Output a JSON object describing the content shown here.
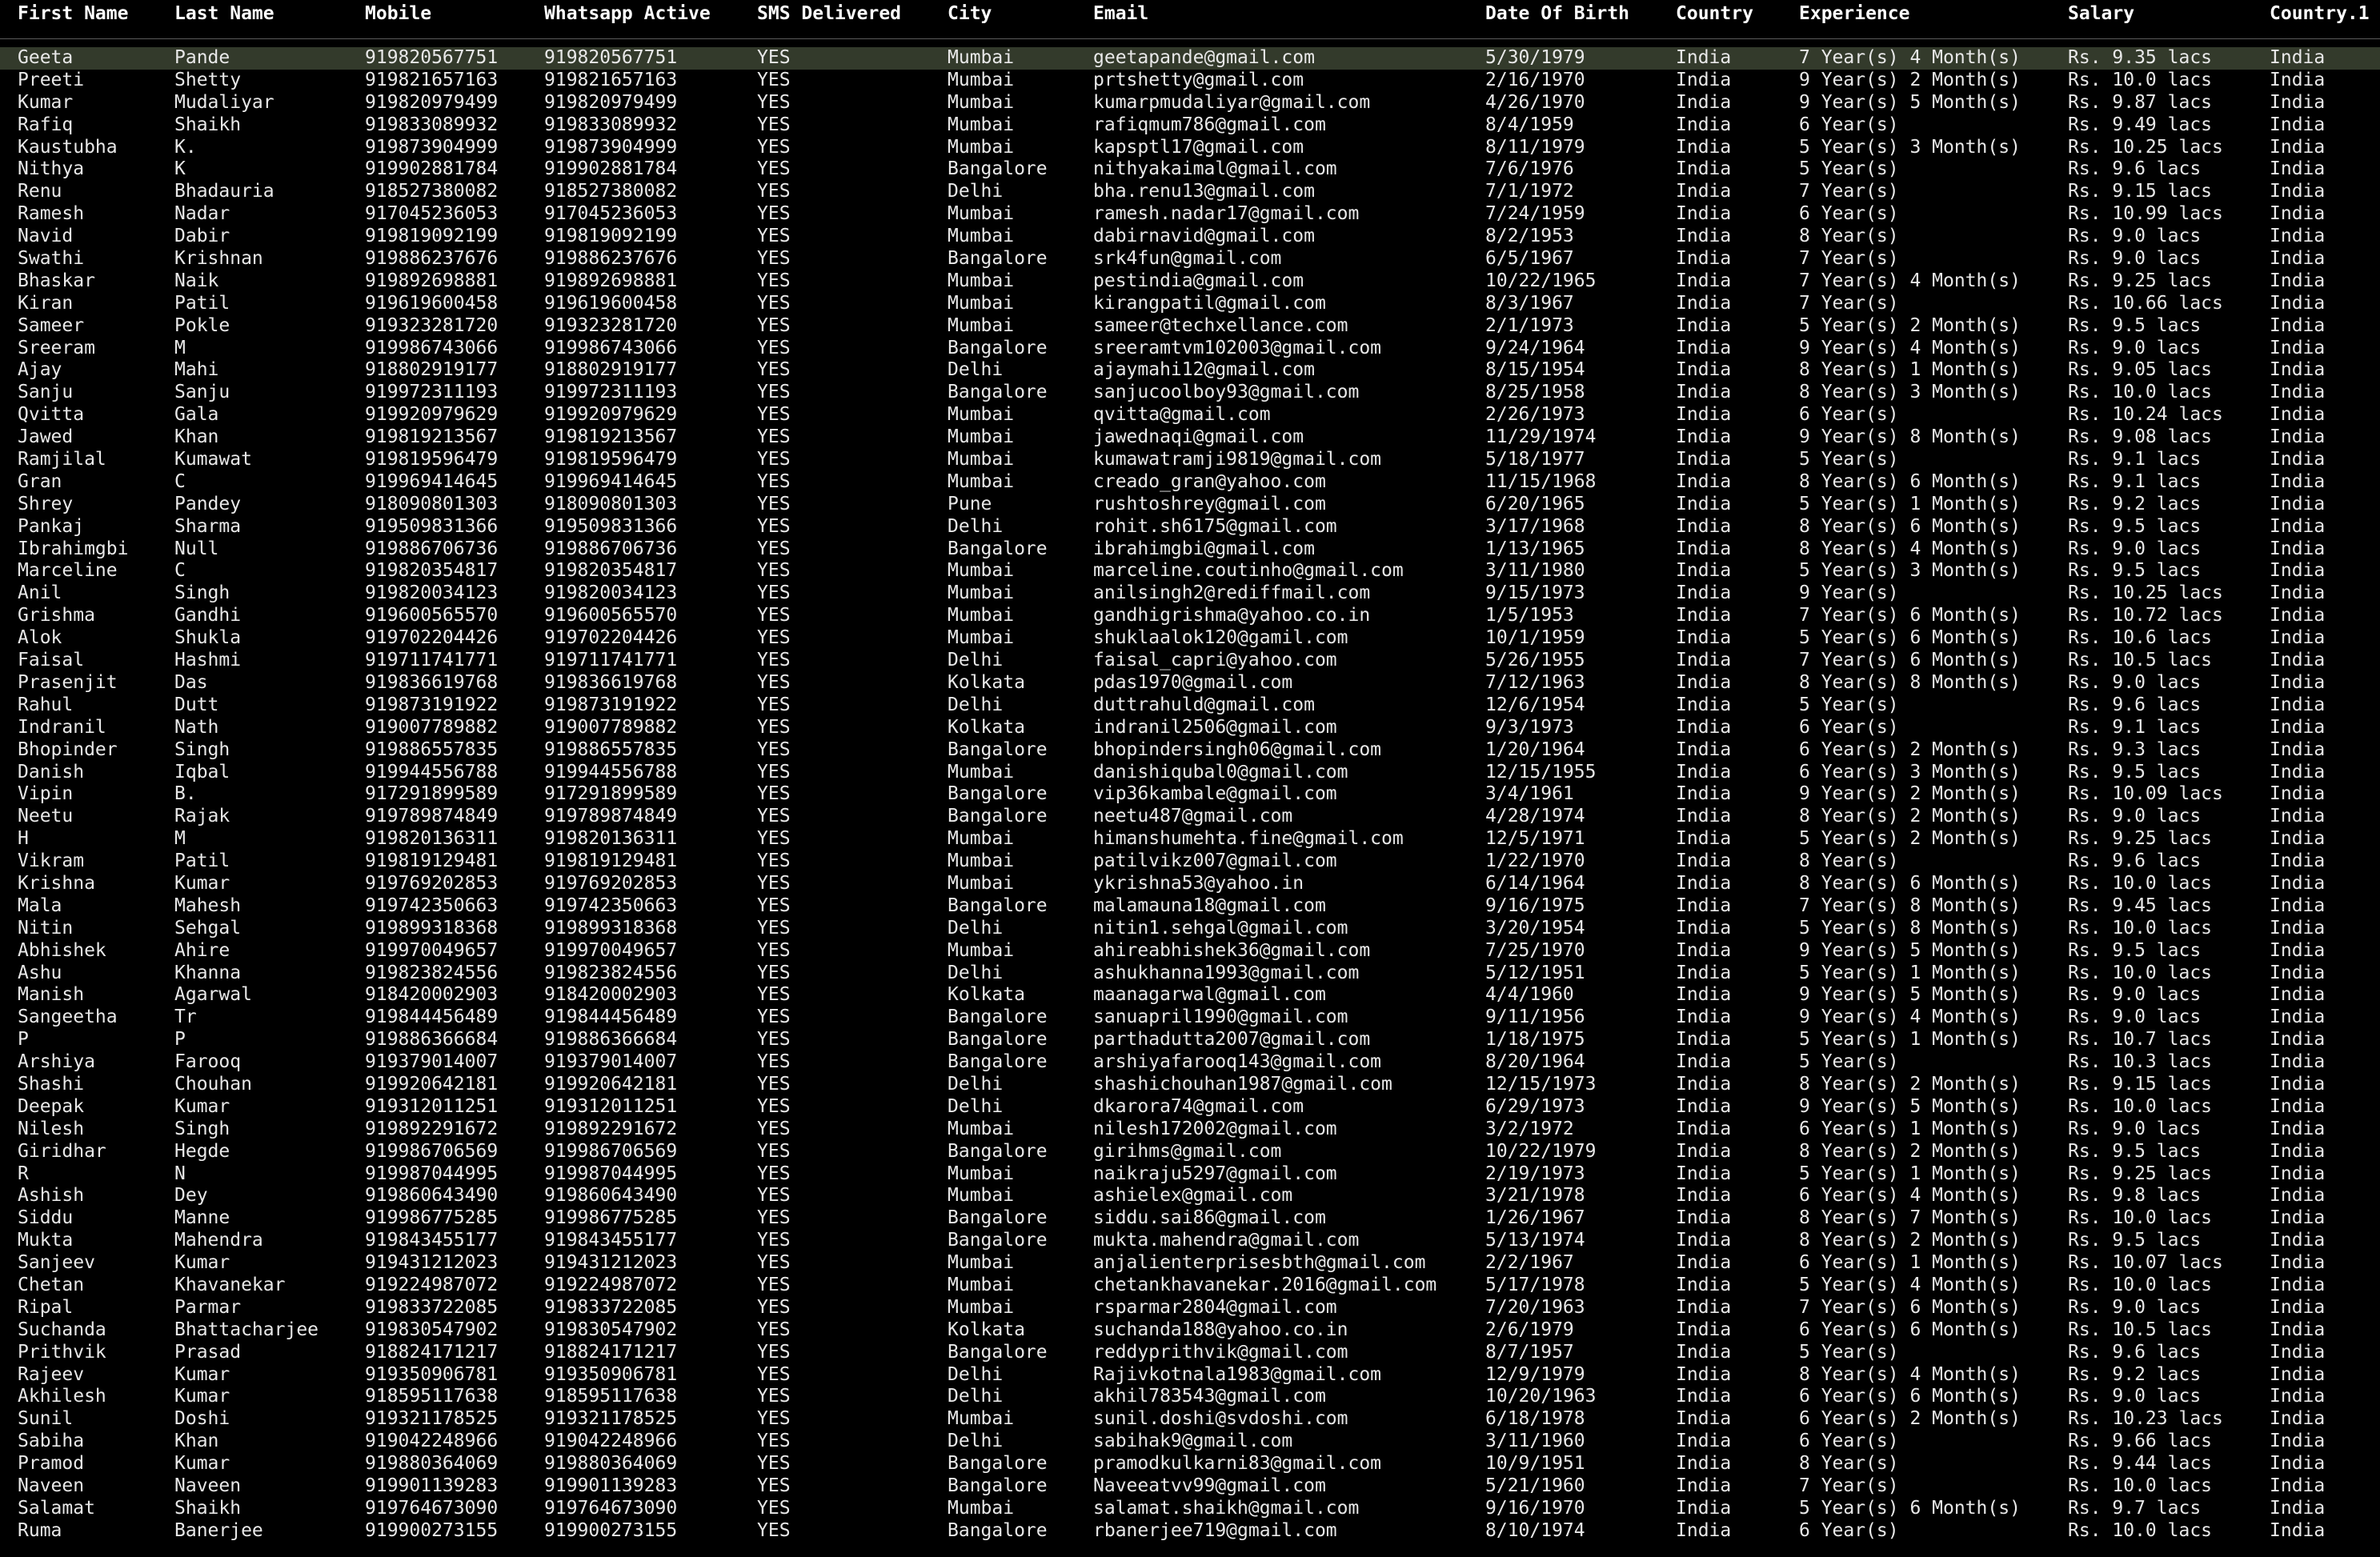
{
  "columns": [
    "First Name",
    "Last Name",
    "Mobile",
    "Whatsapp Active",
    "SMS Delivered",
    "City",
    "Email",
    "Date Of Birth",
    "Country",
    "Experience",
    "Salary",
    "Country.1"
  ],
  "highlight_row": 0,
  "rows": [
    [
      "Geeta",
      "Pande",
      "919820567751",
      "919820567751",
      "YES",
      "Mumbai",
      "geetapande@gmail.com",
      "5/30/1979",
      "India",
      "7 Year(s) 4 Month(s)",
      "Rs. 9.35 lacs",
      "India"
    ],
    [
      "Preeti",
      "Shetty",
      "919821657163",
      "919821657163",
      "YES",
      "Mumbai",
      "prtshetty@gmail.com",
      "2/16/1970",
      "India",
      "9 Year(s) 2 Month(s)",
      "Rs. 10.0 lacs",
      "India"
    ],
    [
      "Kumar",
      "Mudaliyar",
      "919820979499",
      "919820979499",
      "YES",
      "Mumbai",
      "kumarpmudaliyar@gmail.com",
      "4/26/1970",
      "India",
      "9 Year(s) 5 Month(s)",
      "Rs. 9.87 lacs",
      "India"
    ],
    [
      "Rafiq",
      "Shaikh",
      "919833089932",
      "919833089932",
      "YES",
      "Mumbai",
      "rafiqmum786@gmail.com",
      "8/4/1959",
      "India",
      "6 Year(s)",
      "Rs. 9.49 lacs",
      "India"
    ],
    [
      "Kaustubha",
      "K.",
      "919873904999",
      "919873904999",
      "YES",
      "Mumbai",
      "kapsptl17@gmail.com",
      "8/11/1979",
      "India",
      "5 Year(s) 3 Month(s)",
      "Rs. 10.25 lacs",
      "India"
    ],
    [
      "Nithya",
      "K",
      "919902881784",
      "919902881784",
      "YES",
      "Bangalore",
      "nithyakaimal@gmail.com",
      "7/6/1976",
      "India",
      "5 Year(s)",
      "Rs. 9.6 lacs",
      "India"
    ],
    [
      "Renu",
      "Bhadauria",
      "918527380082",
      "918527380082",
      "YES",
      "Delhi",
      "bha.renu13@gmail.com",
      "7/1/1972",
      "India",
      "7 Year(s)",
      "Rs. 9.15 lacs",
      "India"
    ],
    [
      "Ramesh",
      "Nadar",
      "917045236053",
      "917045236053",
      "YES",
      "Mumbai",
      "ramesh.nadar17@gmail.com",
      "7/24/1959",
      "India",
      "6 Year(s)",
      "Rs. 10.99 lacs",
      "India"
    ],
    [
      "Navid",
      "Dabir",
      "919819092199",
      "919819092199",
      "YES",
      "Mumbai",
      "dabirnavid@gmail.com",
      "8/2/1953",
      "India",
      "8 Year(s)",
      "Rs. 9.0 lacs",
      "India"
    ],
    [
      "Swathi",
      "Krishnan",
      "919886237676",
      "919886237676",
      "YES",
      "Bangalore",
      "srk4fun@gmail.com",
      "6/5/1967",
      "India",
      "7 Year(s)",
      "Rs. 9.0 lacs",
      "India"
    ],
    [
      "Bhaskar",
      "Naik",
      "919892698881",
      "919892698881",
      "YES",
      "Mumbai",
      "pestindia@gmail.com",
      "10/22/1965",
      "India",
      "7 Year(s) 4 Month(s)",
      "Rs. 9.25 lacs",
      "India"
    ],
    [
      "Kiran",
      "Patil",
      "919619600458",
      "919619600458",
      "YES",
      "Mumbai",
      "kirangpatil@gmail.com",
      "8/3/1967",
      "India",
      "7 Year(s)",
      "Rs. 10.66 lacs",
      "India"
    ],
    [
      "Sameer",
      "Pokle",
      "919323281720",
      "919323281720",
      "YES",
      "Mumbai",
      "sameer@techxellance.com",
      "2/1/1973",
      "India",
      "5 Year(s) 2 Month(s)",
      "Rs. 9.5 lacs",
      "India"
    ],
    [
      "Sreeram",
      "M",
      "919986743066",
      "919986743066",
      "YES",
      "Bangalore",
      "sreeramtvm102003@gmail.com",
      "9/24/1964",
      "India",
      "9 Year(s) 4 Month(s)",
      "Rs. 9.0 lacs",
      "India"
    ],
    [
      "Ajay",
      "Mahi",
      "918802919177",
      "918802919177",
      "YES",
      "Delhi",
      "ajaymahi12@gmail.com",
      "8/15/1954",
      "India",
      "8 Year(s) 1 Month(s)",
      "Rs. 9.05 lacs",
      "India"
    ],
    [
      "Sanju",
      "Sanju",
      "919972311193",
      "919972311193",
      "YES",
      "Bangalore",
      "sanjucoolboy93@gmail.com",
      "8/25/1958",
      "India",
      "8 Year(s) 3 Month(s)",
      "Rs. 10.0 lacs",
      "India"
    ],
    [
      "Qvitta",
      "Gala",
      "919920979629",
      "919920979629",
      "YES",
      "Mumbai",
      "qvitta@gmail.com",
      "2/26/1973",
      "India",
      "6 Year(s)",
      "Rs. 10.24 lacs",
      "India"
    ],
    [
      "Jawed",
      "Khan",
      "919819213567",
      "919819213567",
      "YES",
      "Mumbai",
      "jawednaqi@gmail.com",
      "11/29/1974",
      "India",
      "9 Year(s) 8 Month(s)",
      "Rs. 9.08 lacs",
      "India"
    ],
    [
      "Ramjilal",
      "Kumawat",
      "919819596479",
      "919819596479",
      "YES",
      "Mumbai",
      "kumawatramji9819@gmail.com",
      "5/18/1977",
      "India",
      "5 Year(s)",
      "Rs. 9.1 lacs",
      "India"
    ],
    [
      "Gran",
      "C",
      "919969414645",
      "919969414645",
      "YES",
      "Mumbai",
      "creado_gran@yahoo.com",
      "11/15/1968",
      "India",
      "8 Year(s) 6 Month(s)",
      "Rs. 9.1 lacs",
      "India"
    ],
    [
      "Shrey",
      "Pandey",
      "918090801303",
      "918090801303",
      "YES",
      "Pune",
      "rushtoshrey@gmail.com",
      "6/20/1965",
      "India",
      "5 Year(s) 1 Month(s)",
      "Rs. 9.2 lacs",
      "India"
    ],
    [
      "Pankaj",
      "Sharma",
      "919509831366",
      "919509831366",
      "YES",
      "Delhi",
      "rohit.sh6175@gmail.com",
      "3/17/1968",
      "India",
      "8 Year(s) 6 Month(s)",
      "Rs. 9.5 lacs",
      "India"
    ],
    [
      "Ibrahimgbi",
      "Null",
      "919886706736",
      "919886706736",
      "YES",
      "Bangalore",
      "ibrahimgbi@gmail.com",
      "1/13/1965",
      "India",
      "8 Year(s) 4 Month(s)",
      "Rs. 9.0 lacs",
      "India"
    ],
    [
      "Marceline",
      "C",
      "919820354817",
      "919820354817",
      "YES",
      "Mumbai",
      "marceline.coutinho@gmail.com",
      "3/11/1980",
      "India",
      "5 Year(s) 3 Month(s)",
      "Rs. 9.5 lacs",
      "India"
    ],
    [
      "Anil",
      "Singh",
      "919820034123",
      "919820034123",
      "YES",
      "Mumbai",
      "anilsingh2@rediffmail.com",
      "9/15/1973",
      "India",
      "9 Year(s)",
      "Rs. 10.25 lacs",
      "India"
    ],
    [
      "Grishma",
      "Gandhi",
      "919600565570",
      "919600565570",
      "YES",
      "Mumbai",
      "gandhigrishma@yahoo.co.in",
      "1/5/1953",
      "India",
      "7 Year(s) 6 Month(s)",
      "Rs. 10.72 lacs",
      "India"
    ],
    [
      "Alok",
      "Shukla",
      "919702204426",
      "919702204426",
      "YES",
      "Mumbai",
      "shuklaalok120@gamil.com",
      "10/1/1959",
      "India",
      "5 Year(s) 6 Month(s)",
      "Rs. 10.6 lacs",
      "India"
    ],
    [
      "Faisal",
      "Hashmi",
      "919711741771",
      "919711741771",
      "YES",
      "Delhi",
      "faisal_capri@yahoo.com",
      "5/26/1955",
      "India",
      "7 Year(s) 6 Month(s)",
      "Rs. 10.5 lacs",
      "India"
    ],
    [
      "Prasenjit",
      "Das",
      "919836619768",
      "919836619768",
      "YES",
      "Kolkata",
      "pdas1970@gmail.com",
      "7/12/1963",
      "India",
      "8 Year(s) 8 Month(s)",
      "Rs. 9.0 lacs",
      "India"
    ],
    [
      "Rahul",
      "Dutt",
      "919873191922",
      "919873191922",
      "YES",
      "Delhi",
      "duttrahuld@gmail.com",
      "12/6/1954",
      "India",
      "5 Year(s)",
      "Rs. 9.6 lacs",
      "India"
    ],
    [
      "Indranil",
      "Nath",
      "919007789882",
      "919007789882",
      "YES",
      "Kolkata",
      "indranil2506@gmail.com",
      "9/3/1973",
      "India",
      "6 Year(s)",
      "Rs. 9.1 lacs",
      "India"
    ],
    [
      "Bhopinder",
      "Singh",
      "919886557835",
      "919886557835",
      "YES",
      "Bangalore",
      "bhopindersingh06@gmail.com",
      "1/20/1964",
      "India",
      "6 Year(s) 2 Month(s)",
      "Rs. 9.3 lacs",
      "India"
    ],
    [
      "Danish",
      "Iqbal",
      "919944556788",
      "919944556788",
      "YES",
      "Mumbai",
      "danishiqubal0@gmail.com",
      "12/15/1955",
      "India",
      "6 Year(s) 3 Month(s)",
      "Rs. 9.5 lacs",
      "India"
    ],
    [
      "Vipin",
      "B.",
      "917291899589",
      "917291899589",
      "YES",
      "Bangalore",
      "vip36kambale@gmail.com",
      "3/4/1961",
      "India",
      "9 Year(s) 2 Month(s)",
      "Rs. 10.09 lacs",
      "India"
    ],
    [
      "Neetu",
      "Rajak",
      "919789874849",
      "919789874849",
      "YES",
      "Bangalore",
      "neetu487@gmail.com",
      "4/28/1974",
      "India",
      "8 Year(s) 2 Month(s)",
      "Rs. 9.0 lacs",
      "India"
    ],
    [
      "H",
      "M",
      "919820136311",
      "919820136311",
      "YES",
      "Mumbai",
      "himanshumehta.fine@gmail.com",
      "12/5/1971",
      "India",
      "5 Year(s) 2 Month(s)",
      "Rs. 9.25 lacs",
      "India"
    ],
    [
      "Vikram",
      "Patil",
      "919819129481",
      "919819129481",
      "YES",
      "Mumbai",
      "patilvikz007@gmail.com",
      "1/22/1970",
      "India",
      "8 Year(s)",
      "Rs. 9.6 lacs",
      "India"
    ],
    [
      "Krishna",
      "Kumar",
      "919769202853",
      "919769202853",
      "YES",
      "Mumbai",
      "ykrishna53@yahoo.in",
      "6/14/1964",
      "India",
      "8 Year(s) 6 Month(s)",
      "Rs. 10.0 lacs",
      "India"
    ],
    [
      "Mala",
      "Mahesh",
      "919742350663",
      "919742350663",
      "YES",
      "Bangalore",
      "malamauna18@gmail.com",
      "9/16/1975",
      "India",
      "7 Year(s) 8 Month(s)",
      "Rs. 9.45 lacs",
      "India"
    ],
    [
      "Nitin",
      "Sehgal",
      "919899318368",
      "919899318368",
      "YES",
      "Delhi",
      "nitin1.sehgal@gmail.com",
      "3/20/1954",
      "India",
      "5 Year(s) 8 Month(s)",
      "Rs. 10.0 lacs",
      "India"
    ],
    [
      "Abhishek",
      "Ahire",
      "919970049657",
      "919970049657",
      "YES",
      "Mumbai",
      "ahireabhishek36@gmail.com",
      "7/25/1970",
      "India",
      "9 Year(s) 5 Month(s)",
      "Rs. 9.5 lacs",
      "India"
    ],
    [
      "Ashu",
      "Khanna",
      "919823824556",
      "919823824556",
      "YES",
      "Delhi",
      "ashukhanna1993@gmail.com",
      "5/12/1951",
      "India",
      "5 Year(s) 1 Month(s)",
      "Rs. 10.0 lacs",
      "India"
    ],
    [
      "Manish",
      "Agarwal",
      "918420002903",
      "918420002903",
      "YES",
      "Kolkata",
      "maanagarwal@gmail.com",
      "4/4/1960",
      "India",
      "9 Year(s) 5 Month(s)",
      "Rs. 9.0 lacs",
      "India"
    ],
    [
      "Sangeetha",
      "Tr",
      "919844456489",
      "919844456489",
      "YES",
      "Bangalore",
      "sanuapril1990@gmail.com",
      "9/11/1956",
      "India",
      "9 Year(s) 4 Month(s)",
      "Rs. 9.0 lacs",
      "India"
    ],
    [
      "P",
      "P",
      "919886366684",
      "919886366684",
      "YES",
      "Bangalore",
      "parthadutta2007@gmail.com",
      "1/18/1975",
      "India",
      "5 Year(s) 1 Month(s)",
      "Rs. 10.7 lacs",
      "India"
    ],
    [
      "Arshiya",
      "Farooq",
      "919379014007",
      "919379014007",
      "YES",
      "Bangalore",
      "arshiyafarooq143@gmail.com",
      "8/20/1964",
      "India",
      "5 Year(s)",
      "Rs. 10.3 lacs",
      "India"
    ],
    [
      "Shashi",
      "Chouhan",
      "919920642181",
      "919920642181",
      "YES",
      "Delhi",
      "shashichouhan1987@gmail.com",
      "12/15/1973",
      "India",
      "8 Year(s) 2 Month(s)",
      "Rs. 9.15 lacs",
      "India"
    ],
    [
      "Deepak",
      "Kumar",
      "919312011251",
      "919312011251",
      "YES",
      "Delhi",
      "dkarora74@gmail.com",
      "6/29/1973",
      "India",
      "9 Year(s) 5 Month(s)",
      "Rs. 10.0 lacs",
      "India"
    ],
    [
      "Nilesh",
      "Singh",
      "919892291672",
      "919892291672",
      "YES",
      "Mumbai",
      "nilesh172002@gmail.com",
      "3/2/1972",
      "India",
      "6 Year(s) 1 Month(s)",
      "Rs. 9.0 lacs",
      "India"
    ],
    [
      "Giridhar",
      "Hegde",
      "919986706569",
      "919986706569",
      "YES",
      "Bangalore",
      "girihms@gmail.com",
      "10/22/1979",
      "India",
      "8 Year(s) 2 Month(s)",
      "Rs. 9.5 lacs",
      "India"
    ],
    [
      "R",
      "N",
      "919987044995",
      "919987044995",
      "YES",
      "Mumbai",
      "naikraju5297@gmail.com",
      "2/19/1973",
      "India",
      "5 Year(s) 1 Month(s)",
      "Rs. 9.25 lacs",
      "India"
    ],
    [
      "Ashish",
      "Dey",
      "919860643490",
      "919860643490",
      "YES",
      "Mumbai",
      "ashielex@gmail.com",
      "3/21/1978",
      "India",
      "6 Year(s) 4 Month(s)",
      "Rs. 9.8 lacs",
      "India"
    ],
    [
      "Siddu",
      "Manne",
      "919986775285",
      "919986775285",
      "YES",
      "Bangalore",
      "siddu.sai86@gmail.com",
      "1/26/1967",
      "India",
      "8 Year(s) 7 Month(s)",
      "Rs. 10.0 lacs",
      "India"
    ],
    [
      "Mukta",
      "Mahendra",
      "919843455177",
      "919843455177",
      "YES",
      "Bangalore",
      "mukta.mahendra@gmail.com",
      "5/13/1974",
      "India",
      "8 Year(s) 2 Month(s)",
      "Rs. 9.5 lacs",
      "India"
    ],
    [
      "Sanjeev",
      "Kumar",
      "919431212023",
      "919431212023",
      "YES",
      "Mumbai",
      "anjalienterprisesbth@gmail.com",
      "2/2/1967",
      "India",
      "6 Year(s) 1 Month(s)",
      "Rs. 10.07 lacs",
      "India"
    ],
    [
      "Chetan",
      "Khavanekar",
      "919224987072",
      "919224987072",
      "YES",
      "Mumbai",
      "chetankhavanekar.2016@gmail.com",
      "5/17/1978",
      "India",
      "5 Year(s) 4 Month(s)",
      "Rs. 10.0 lacs",
      "India"
    ],
    [
      "Ripal",
      "Parmar",
      "919833722085",
      "919833722085",
      "YES",
      "Mumbai",
      "rsparmar2804@gmail.com",
      "7/20/1963",
      "India",
      "7 Year(s) 6 Month(s)",
      "Rs. 9.0 lacs",
      "India"
    ],
    [
      "Suchanda",
      "Bhattacharjee",
      "919830547902",
      "919830547902",
      "YES",
      "Kolkata",
      "suchanda188@yahoo.co.in",
      "2/6/1979",
      "India",
      "6 Year(s) 6 Month(s)",
      "Rs. 10.5 lacs",
      "India"
    ],
    [
      "Prithvik",
      "Prasad",
      "918824171217",
      "918824171217",
      "YES",
      "Bangalore",
      "reddyprithvik@gmail.com",
      "8/7/1957",
      "India",
      "5 Year(s)",
      "Rs. 9.6 lacs",
      "India"
    ],
    [
      "Rajeev",
      "Kumar",
      "919350906781",
      "919350906781",
      "YES",
      "Delhi",
      "Rajivkotnala1983@gmail.com",
      "12/9/1979",
      "India",
      "8 Year(s) 4 Month(s)",
      "Rs. 9.2 lacs",
      "India"
    ],
    [
      "Akhilesh",
      "Kumar",
      "918595117638",
      "918595117638",
      "YES",
      "Delhi",
      "akhil783543@gmail.com",
      "10/20/1963",
      "India",
      "6 Year(s) 6 Month(s)",
      "Rs. 9.0 lacs",
      "India"
    ],
    [
      "Sunil",
      "Doshi",
      "919321178525",
      "919321178525",
      "YES",
      "Mumbai",
      "sunil.doshi@svdoshi.com",
      "6/18/1978",
      "India",
      "6 Year(s) 2 Month(s)",
      "Rs. 10.23 lacs",
      "India"
    ],
    [
      "Sabiha",
      "Khan",
      "919042248966",
      "919042248966",
      "YES",
      "Delhi",
      "sabihak9@gmail.com",
      "3/11/1960",
      "India",
      "6 Year(s)",
      "Rs. 9.66 lacs",
      "India"
    ],
    [
      "Pramod",
      "Kumar",
      "919880364069",
      "919880364069",
      "YES",
      "Bangalore",
      "pramodkulkarni83@gmail.com",
      "10/9/1951",
      "India",
      "8 Year(s)",
      "Rs. 9.44 lacs",
      "India"
    ],
    [
      "Naveen",
      "Naveen",
      "919901139283",
      "919901139283",
      "YES",
      "Bangalore",
      "Naveeatvv99@gmail.com",
      "5/21/1960",
      "India",
      "7 Year(s)",
      "Rs. 10.0 lacs",
      "India"
    ],
    [
      "Salamat",
      "Shaikh",
      "919764673090",
      "919764673090",
      "YES",
      "Mumbai",
      "salamat.shaikh@gmail.com",
      "9/16/1970",
      "India",
      "5 Year(s) 6 Month(s)",
      "Rs. 9.7 lacs",
      "India"
    ],
    [
      "Ruma",
      "Banerjee",
      "919900273155",
      "919900273155",
      "YES",
      "Bangalore",
      "rbanerjee719@gmail.com",
      "8/10/1974",
      "India",
      "6 Year(s)",
      "Rs. 10.0 lacs",
      "India"
    ]
  ]
}
